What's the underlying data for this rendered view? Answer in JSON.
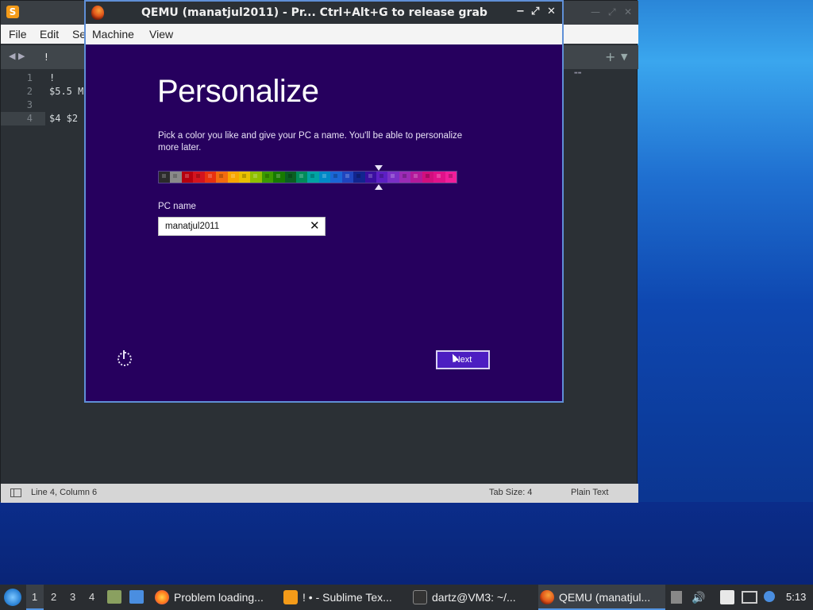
{
  "sublime": {
    "title_icon": "sublime-text-logo",
    "menu": [
      "File",
      "Edit",
      "Se"
    ],
    "tab_label": "!",
    "lines": [
      {
        "num": "1",
        "text": "!"
      },
      {
        "num": "2",
        "text": "$5.5 M"
      },
      {
        "num": "3",
        "text": ""
      },
      {
        "num": "4",
        "text": "$4 $2"
      }
    ],
    "status": {
      "position": "Line 4, Column 6",
      "tab_size": "Tab Size: 4",
      "syntax": "Plain Text"
    }
  },
  "qemu": {
    "title": "QEMU (manatjul2011) - Pr...  Ctrl+Alt+G to release grab",
    "menu": [
      "Machine",
      "View"
    ],
    "buttons": {
      "minimize": "−",
      "maximize": "⤢",
      "close": "✕"
    }
  },
  "guest": {
    "heading": "Personalize",
    "description": "Pick a color you like and give your PC a name. You'll be able to personalize more later.",
    "pc_name_label": "PC name",
    "pc_name_value": "manatjul2011",
    "clear_glyph": "✕",
    "next_label": "Next",
    "palette": [
      "#2b2b2b",
      "#8a8a8a",
      "#b5000f",
      "#d4141e",
      "#e8310f",
      "#f26c0f",
      "#f7a600",
      "#e8c000",
      "#8fbf00",
      "#3b9a00",
      "#177a00",
      "#0b5e22",
      "#008b5a",
      "#00a3a3",
      "#0089c7",
      "#1a66d6",
      "#1f45bf",
      "#12258f",
      "#3a0fa0",
      "#5d1fc4",
      "#7a2fc7",
      "#9b2bb5",
      "#b3199a",
      "#d10f7e",
      "#e0128a",
      "#f01e9a"
    ],
    "selected_index": 18
  },
  "taskbar": {
    "workspaces": [
      "1",
      "2",
      "3",
      "4"
    ],
    "active_workspace": "1",
    "apps": [
      {
        "label": "Problem loading...",
        "icon": "firefox-icon",
        "color": "#ff7a1a"
      },
      {
        "label": "! • - Sublime Tex...",
        "icon": "sublime-icon",
        "color": "#f49b19"
      },
      {
        "label": "dartz@VM3: ~/...",
        "icon": "terminal-icon",
        "color": "#444"
      },
      {
        "label": "QEMU (manatjul...",
        "icon": "qemu-icon",
        "color": "#e1561a"
      }
    ],
    "clock": "5:13"
  }
}
